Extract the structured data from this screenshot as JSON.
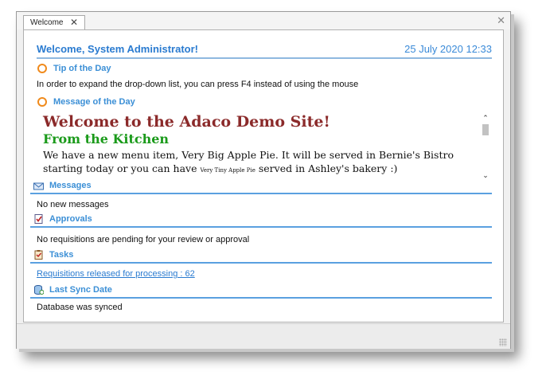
{
  "tab": {
    "label": "Welcome",
    "close": "✕"
  },
  "window_close": "✕",
  "header": {
    "welcome": "Welcome, System Administrator!",
    "date": "25 July 2020 12:33"
  },
  "tip": {
    "label": "Tip of the Day",
    "text": "In order to expand the drop-down list, you can press F4 instead of using the mouse"
  },
  "motd": {
    "label": "Message of the Day",
    "title": "Welcome to the Adaco Demo Site!",
    "subtitle": "From the Kitchen",
    "body_part1": "We have a new menu item, Very Big Apple Pie. It will be served in Bernie's Bistro starting today or you can have",
    "body_small": "Very Tiny Apple Pie",
    "body_part2": "served in Ashley's bakery :)"
  },
  "messages": {
    "label": "Messages",
    "text": "No new messages"
  },
  "approvals": {
    "label": "Approvals",
    "text": "No requisitions are pending for your review or approval"
  },
  "tasks": {
    "label": "Tasks",
    "link": "Requisitions released for processing : 62"
  },
  "sync": {
    "label": "Last Sync Date",
    "text": "Database was synced"
  },
  "colors": {
    "accent": "#2a7bd0",
    "orange": "#f08a1c",
    "motd_title": "#8b2a2a",
    "motd_sub": "#1a9a1a"
  },
  "icons": {
    "messages": "envelope-icon",
    "approvals": "document-check-icon",
    "tasks": "clipboard-icon",
    "sync": "database-sync-icon"
  }
}
